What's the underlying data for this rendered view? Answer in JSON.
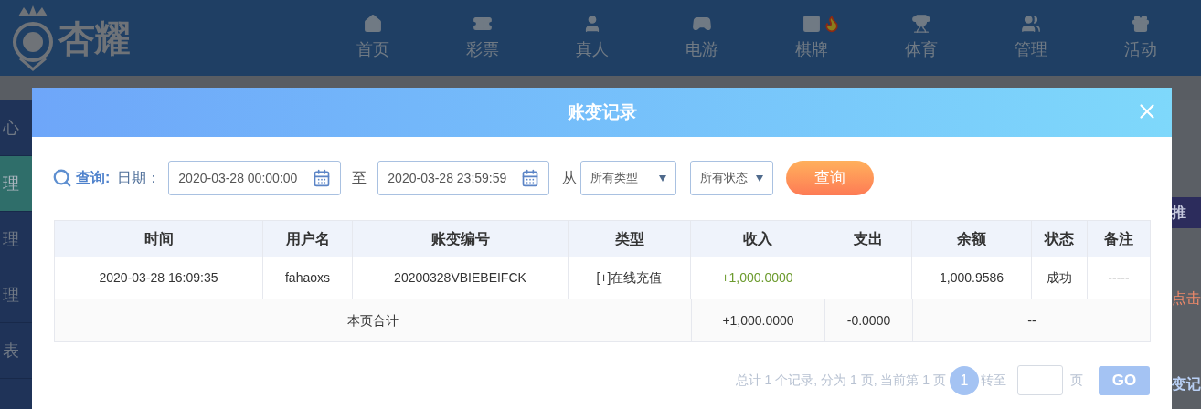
{
  "header": {
    "logo_text": "杏耀",
    "nav": [
      {
        "label": "首页",
        "hot": false
      },
      {
        "label": "彩票",
        "hot": false
      },
      {
        "label": "真人",
        "hot": false
      },
      {
        "label": "电游",
        "hot": false
      },
      {
        "label": "棋牌",
        "hot": true
      },
      {
        "label": "体育",
        "hot": false
      },
      {
        "label": "管理",
        "hot": false
      },
      {
        "label": "活动",
        "hot": false
      }
    ]
  },
  "sidebar": {
    "items": [
      {
        "label": "心",
        "selected": false
      },
      {
        "label": "理",
        "selected": true
      },
      {
        "label": "理",
        "selected": false
      },
      {
        "label": "理",
        "selected": false
      },
      {
        "label": "表",
        "selected": false
      }
    ]
  },
  "side_fragments": [
    {
      "text": "推",
      "kind": "tab"
    },
    {
      "text": "点击",
      "kind": "link"
    },
    {
      "text": "变记",
      "kind": "title"
    }
  ],
  "modal": {
    "title": "账变记录",
    "filters": {
      "query_label": "查询:",
      "date_label": "日期：",
      "start_date": "2020-03-28 00:00:00",
      "to_label": "至",
      "end_date": "2020-03-28 23:59:59",
      "from_label": "从",
      "type_select": "所有类型",
      "status_select": "所有状态",
      "search_button": "查询"
    },
    "table": {
      "columns": [
        "时间",
        "用户名",
        "账变编号",
        "类型",
        "收入",
        "支出",
        "余额",
        "状态",
        "备注"
      ],
      "rows": [
        {
          "time": "2020-03-28 16:09:35",
          "username": "fahaoxs",
          "number": "20200328VBIEBEIFCK",
          "type": "[+]在线充值",
          "income": "+1,000.0000",
          "expense": "",
          "balance": "1,000.9586",
          "status": "成功",
          "note": "-----"
        }
      ],
      "total": {
        "label": "本页合计",
        "income": "+1,000.0000",
        "expense": "-0.0000",
        "balance": "--"
      }
    },
    "pagination": {
      "summary": "总计 1 个记录, 分为 1 页, 当前第 1 页",
      "current_page": "1",
      "goto_label": "转至",
      "page_label": "页",
      "go_button": "GO"
    }
  }
}
